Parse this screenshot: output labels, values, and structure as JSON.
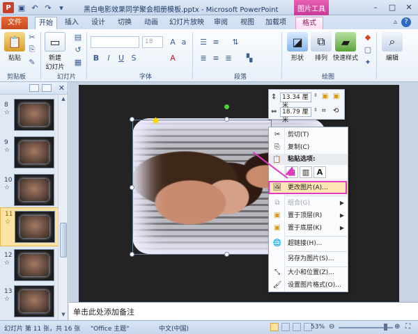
{
  "window": {
    "title": "黑白电影效果同学聚会相册模板.pptx - Microsoft PowerPoint",
    "tool_tab": "图片工具",
    "app_icon": "P"
  },
  "tabs": [
    {
      "label": "文件"
    },
    {
      "label": "开始"
    },
    {
      "label": "插入"
    },
    {
      "label": "设计"
    },
    {
      "label": "切换"
    },
    {
      "label": "动画"
    },
    {
      "label": "幻灯片放映"
    },
    {
      "label": "审阅"
    },
    {
      "label": "视图"
    },
    {
      "label": "加载项"
    },
    {
      "label": "格式"
    }
  ],
  "ribbon": {
    "paste": "粘贴",
    "new_slide": "新建",
    "new_slide2": "幻灯片",
    "font_size": "18",
    "shape": "形状",
    "arrange": "排列",
    "quick_styles": "快速样式",
    "edit": "编辑",
    "groups": {
      "clipboard": "剪贴板",
      "slides": "幻灯片",
      "font": "字体",
      "paragraph": "段落",
      "drawing": "绘图"
    }
  },
  "slide_panel": {
    "items": [
      {
        "num": "8"
      },
      {
        "num": "9"
      },
      {
        "num": "10"
      },
      {
        "num": "11"
      },
      {
        "num": "12"
      },
      {
        "num": "13"
      }
    ],
    "mark": "☆"
  },
  "mini_toolbar": {
    "height": "13.34 厘米",
    "width": "18.79 厘米"
  },
  "context_menu": {
    "cut": "剪切(T)",
    "copy": "复制(C)",
    "paste_header": "粘贴选项:",
    "change_picture": "更改图片(A)...",
    "group": "组合(G)",
    "bring_front": "置于顶层(R)",
    "send_back": "置于底层(K)",
    "hyperlink": "超链接(H)...",
    "save_as_picture": "另存为图片(S)...",
    "size_position": "大小和位置(Z)...",
    "format_picture": "设置图片格式(O)..."
  },
  "notes": {
    "placeholder": "单击此处添加备注"
  },
  "status": {
    "slide_info": "幻灯片 第 11 张，共 16 张",
    "theme": "\"Office 主题\"",
    "language": "中文(中国)",
    "zoom": "53%"
  }
}
